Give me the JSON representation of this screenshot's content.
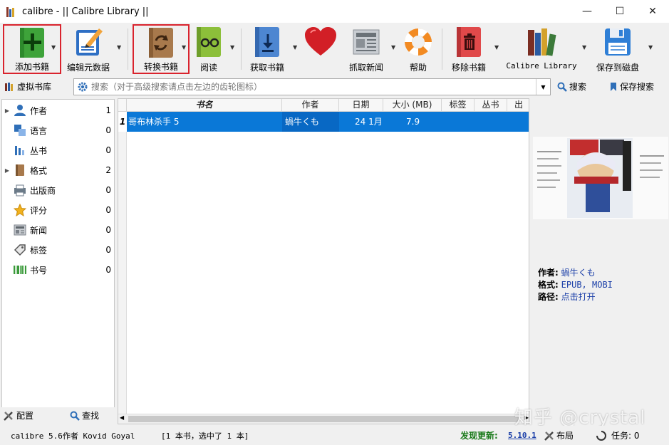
{
  "window": {
    "title": "calibre - || Calibre Library ||",
    "minimize_glyph": "—",
    "maximize_glyph": "☐",
    "close_glyph": "✕"
  },
  "toolbar": {
    "add_book": "添加书籍",
    "edit_metadata": "编辑元数据",
    "convert_books": "转换书籍",
    "view": "阅读",
    "get_books": "获取书籍",
    "donate": "",
    "fetch_news": "抓取新闻",
    "help": "帮助",
    "remove_books": "移除书籍",
    "library": "Calibre Library",
    "save_to_disk": "保存到磁盘",
    "arrow_glyph": "▼"
  },
  "searchbar": {
    "virtual_library": "虚拟书库",
    "placeholder": "搜索（对于高级搜索请点击左边的齿轮图标）",
    "search_button": "搜索",
    "saved_search_button": "保存搜索"
  },
  "tag_browser": {
    "categories": [
      {
        "name": "作者",
        "count": "1",
        "expandable": true
      },
      {
        "name": "语言",
        "count": "0",
        "expandable": false
      },
      {
        "name": "丛书",
        "count": "0",
        "expandable": false
      },
      {
        "name": "格式",
        "count": "2",
        "expandable": true
      },
      {
        "name": "出版商",
        "count": "0",
        "expandable": false
      },
      {
        "name": "评分",
        "count": "0",
        "expandable": false
      },
      {
        "name": "新闻",
        "count": "0",
        "expandable": false
      },
      {
        "name": "标签",
        "count": "0",
        "expandable": false
      },
      {
        "name": "书号",
        "count": "0",
        "expandable": false
      }
    ],
    "configure": "配置",
    "find": "查找"
  },
  "book_list": {
    "columns": [
      "书名",
      "作者",
      "日期",
      "大小 (MB)",
      "标签",
      "丛书",
      "出"
    ],
    "rows": [
      {
        "num": "1",
        "title": "哥布林杀手 5",
        "author": "蝸牛くも",
        "date": "24 1月 ...",
        "size": "7.9"
      }
    ]
  },
  "book_details": {
    "author_label": "作者:",
    "author_value": "蝸牛くも",
    "format_label": "格式:",
    "format_value": "EPUB, MOBI",
    "path_label": "路径:",
    "path_value": "点击打开"
  },
  "statusbar": {
    "version": "calibre 5.6作者 Kovid Goyal",
    "selection": "[1 本书，选中了 1 本]",
    "update_label": "发现更新:",
    "update_version": "5.10.1",
    "layout": "布局",
    "jobs": "任务: 0"
  },
  "watermark": "知乎 @crystal",
  "colors": {
    "selection": "#0a78d7",
    "highlight_border": "#d9232d",
    "update_green": "#1a7a1a",
    "details_blue": "#1b3fa8"
  }
}
